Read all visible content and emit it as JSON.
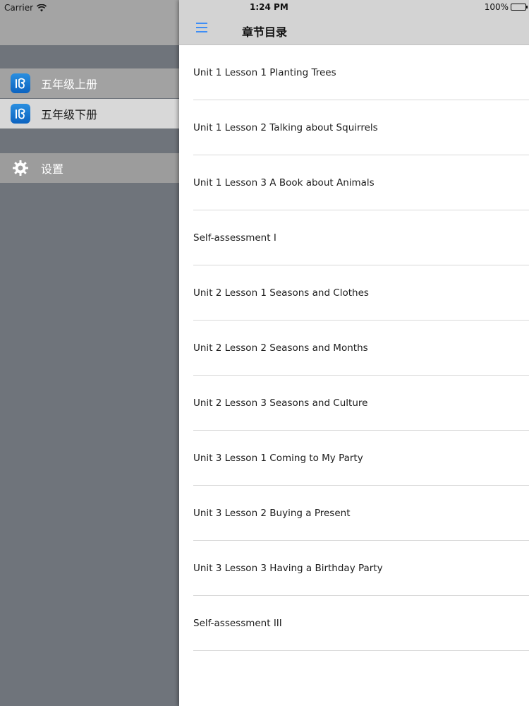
{
  "status_bar": {
    "carrier": "Carrier",
    "time": "1:24 PM",
    "battery": "100%"
  },
  "sidebar": {
    "books": [
      {
        "label": "五年级上册",
        "icon": "book-app-icon"
      },
      {
        "label": "五年级下册",
        "icon": "book-app-icon",
        "active": true
      }
    ],
    "settings": {
      "label": "设置",
      "icon": "gear-icon"
    }
  },
  "header": {
    "title": "章节目录",
    "menu_icon": "hamburger-menu-icon"
  },
  "chapters": [
    "Unit 1 Lesson 1 Planting Trees",
    "Unit 1 Lesson 2 Talking about Squirrels",
    "Unit 1 Lesson 3 A Book about Animals",
    "Self-assessment I",
    "Unit 2 Lesson 1 Seasons and Clothes",
    "Unit 2 Lesson 2 Seasons and Months",
    "Unit 2 Lesson 3 Seasons and Culture",
    "Unit 3 Lesson 1 Coming to My Party",
    "Unit 3 Lesson 2 Buying a Present",
    "Unit 3 Lesson 3 Having a Birthday Party",
    "Self-assessment III"
  ],
  "colors": {
    "accent": "#3f8ef5",
    "sidebar_bg": "#6f747b",
    "active_row": "#d8d8d8"
  }
}
